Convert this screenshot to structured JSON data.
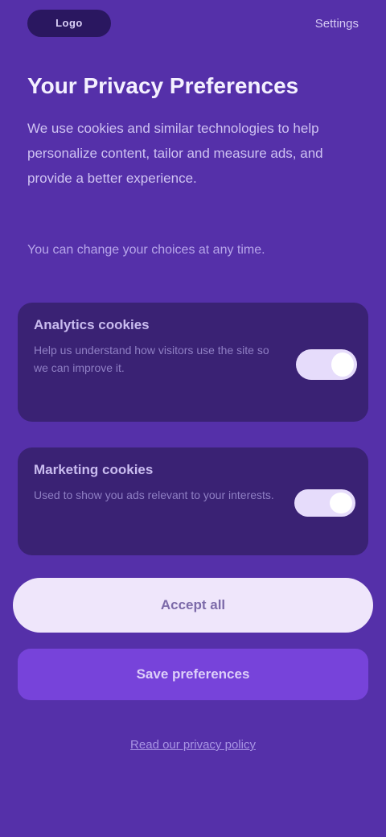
{
  "header": {
    "logo_text": "Logo",
    "top_link": "Settings"
  },
  "main": {
    "title": "Your Privacy Preferences",
    "description": "We use cookies and similar technologies to help personalize content, tailor and measure ads, and provide a better experience.",
    "sub_note": "You can change your choices at any time."
  },
  "cards": [
    {
      "title": "Analytics cookies",
      "description": "Help us understand how visitors use the site so we can improve it.",
      "enabled": true
    },
    {
      "title": "Marketing cookies",
      "description": "Used to show you ads relevant to your interests.",
      "enabled": true
    }
  ],
  "actions": {
    "primary_label": "Accept all",
    "secondary_label": "Save preferences"
  },
  "footer": {
    "link_label": "Read our privacy policy"
  },
  "colors": {
    "background": "#5530a9",
    "card": "#3a2274",
    "primary_button": "#efe6fb",
    "secondary_button": "#7743da"
  }
}
